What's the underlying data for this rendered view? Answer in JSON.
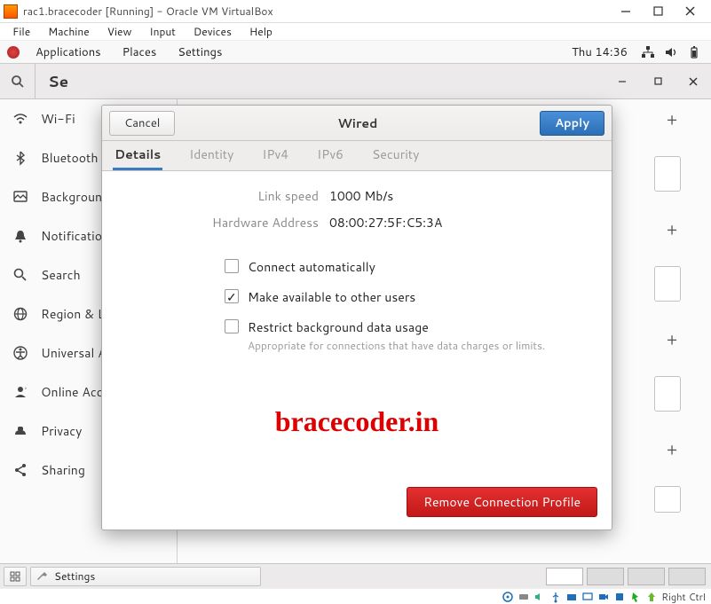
{
  "window": {
    "title": "rac1.bracecoder [Running] - Oracle VM VirtualBox"
  },
  "vb_menu": [
    "File",
    "Machine",
    "View",
    "Input",
    "Devices",
    "Help"
  ],
  "gnome": {
    "applications": "Applications",
    "places": "Places",
    "settings": "Settings",
    "clock": "Thu 14:36"
  },
  "settings_window": {
    "title": "Se"
  },
  "sidebar": {
    "items": [
      {
        "label": "Wi-Fi"
      },
      {
        "label": "Bluetooth"
      },
      {
        "label": "Background"
      },
      {
        "label": "Notifications"
      },
      {
        "label": "Search"
      },
      {
        "label": "Region & L"
      },
      {
        "label": "Universal A"
      },
      {
        "label": "Online Acc"
      },
      {
        "label": "Privacy"
      },
      {
        "label": "Sharing"
      }
    ]
  },
  "dialog": {
    "cancel": "Cancel",
    "apply": "Apply",
    "title": "Wired",
    "tabs": [
      "Details",
      "Identity",
      "IPv4",
      "IPv6",
      "Security"
    ],
    "details": {
      "link_speed_label": "Link speed",
      "link_speed_value": "1000 Mb/s",
      "hw_addr_label": "Hardware Address",
      "hw_addr_value": "08:00:27:5F:C5:3A"
    },
    "checkboxes": {
      "connect_auto": "Connect automatically",
      "make_available": "Make available to other users",
      "restrict_bg": "Restrict background data usage",
      "restrict_bg_desc": "Appropriate for connections that have data charges or limits."
    },
    "remove": "Remove Connection Profile"
  },
  "watermark": "bracecoder.in",
  "taskbar": {
    "settings": "Settings"
  },
  "vb_status": {
    "host_key": "Right Ctrl"
  }
}
